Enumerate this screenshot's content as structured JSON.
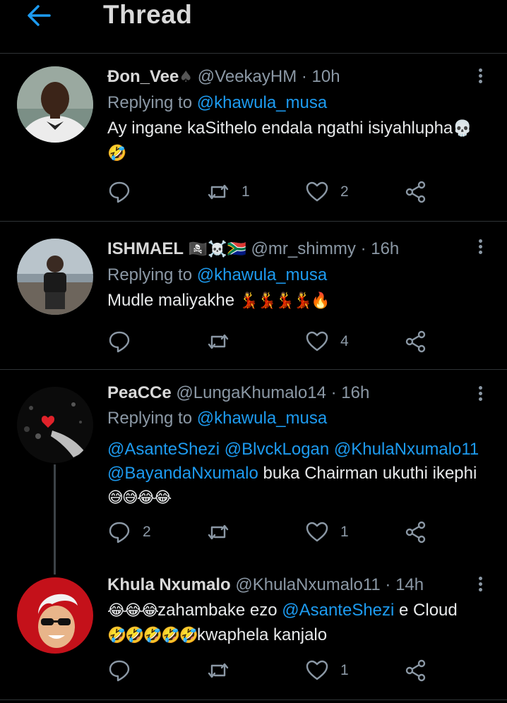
{
  "header": {
    "title": "Thread"
  },
  "tweets": [
    {
      "name": "Đon_Vee",
      "name_suffix": "♠",
      "handle": "@VeekayHM",
      "time": "· 10h",
      "replying_label": "Replying to",
      "replying_to": "@khawula_musa",
      "text": "Ay ingane kaSithelo endala ngathi isiyahlupha",
      "text_emoji": "💀",
      "text_line2_emoji": "🤣",
      "replies": "",
      "retweets": "1",
      "likes": "2"
    },
    {
      "name": "ISHMAEL",
      "name_suffix": "🏴‍☠️☠️🇿🇦",
      "handle": "@mr_shimmy",
      "time": "· 16h",
      "replying_label": "Replying to",
      "replying_to": "@khawula_musa",
      "text": "Mudle maliyakhe",
      "text_emoji": "💃💃💃💃🔥",
      "replies": "",
      "retweets": "",
      "likes": "4"
    },
    {
      "name": "PeaCCe",
      "handle": "@LungaKhumalo14",
      "time": "· 16h",
      "replying_label": "Replying to",
      "replying_to": "@khawula_musa",
      "mention1": "@AsanteShezi",
      "mention2": "@BlvckLogan",
      "mention3": "@KhulaNxumalo11",
      "mention4": "@BayandaNxumalo",
      "text": " buka Chairman ukuthi ikephi",
      "text_line3_emoji": "😅😅😂😂",
      "replies": "2",
      "retweets": "",
      "likes": "1"
    },
    {
      "name": "Khula Nxumalo",
      "handle": "@KhulaNxumalo11",
      "time": "· 14h",
      "lead_emoji": "😂😂😂",
      "text_a": "zahambake ezo ",
      "mention": "@AsanteShezi",
      "text_b": "  e Cloud",
      "line2_emoji": "🤣🤣🤣🤣🤣",
      "text_c": "kwaphela kanjalo",
      "replies": "",
      "retweets": "",
      "likes": "1"
    }
  ],
  "colors": {
    "accent": "#1d9bf0",
    "background": "#000000",
    "muted": "#8b98a5",
    "divider": "#2f3336"
  },
  "icons": [
    "back-arrow-icon",
    "more-icon",
    "reply-icon",
    "retweet-icon",
    "like-icon",
    "share-icon"
  ]
}
